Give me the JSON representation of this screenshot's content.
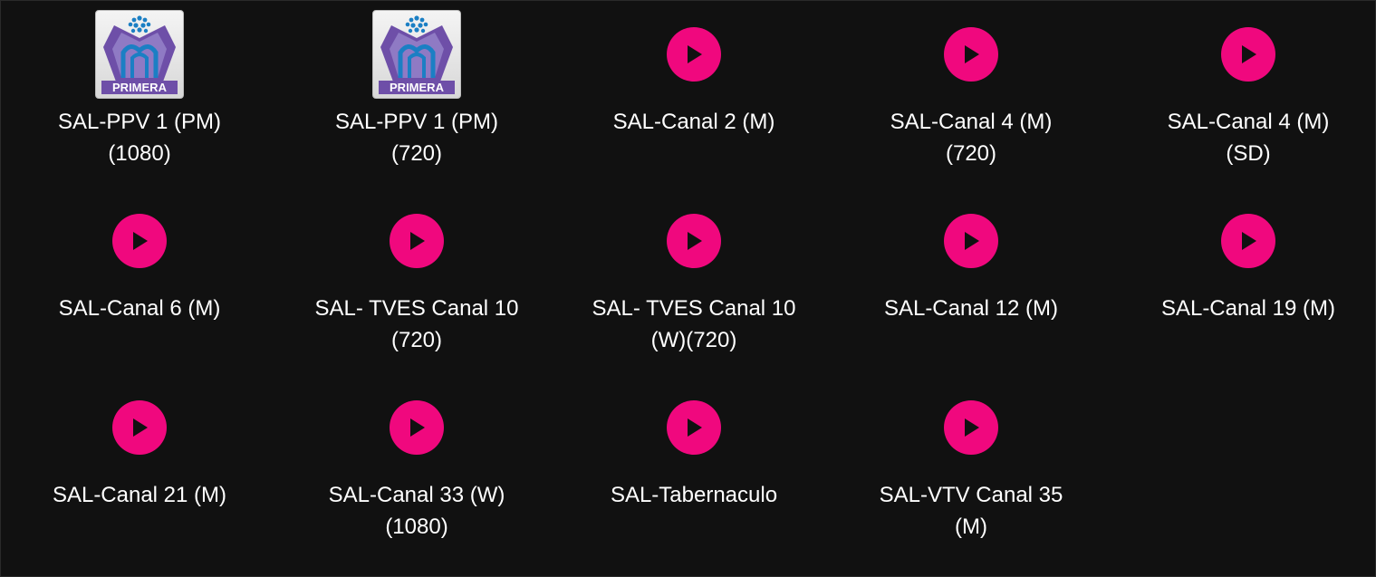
{
  "colors": {
    "background": "#111111",
    "play_accent": "#f0087e",
    "text": "#ffffff",
    "logo_purple": "#6e4fa8",
    "logo_blue": "#1b7fc4"
  },
  "channels": [
    {
      "label": "SAL-PPV 1 (PM)\n(1080)",
      "icon": "primera-logo-icon",
      "logo_text": "PRIMERA"
    },
    {
      "label": "SAL-PPV 1 (PM)\n(720)",
      "icon": "primera-logo-icon",
      "logo_text": "PRIMERA"
    },
    {
      "label": "SAL-Canal 2 (M)",
      "icon": "play-icon"
    },
    {
      "label": "SAL-Canal 4 (M)\n(720)",
      "icon": "play-icon"
    },
    {
      "label": "SAL-Canal 4 (M)\n(SD)",
      "icon": "play-icon"
    },
    {
      "label": "SAL-Canal 6 (M)",
      "icon": "play-icon"
    },
    {
      "label": "SAL- TVES Canal 10\n(720)",
      "icon": "play-icon"
    },
    {
      "label": "SAL- TVES Canal 10\n(W)(720)",
      "icon": "play-icon"
    },
    {
      "label": "SAL-Canal 12 (M)",
      "icon": "play-icon"
    },
    {
      "label": "SAL-Canal 19 (M)",
      "icon": "play-icon"
    },
    {
      "label": "SAL-Canal 21 (M)",
      "icon": "play-icon"
    },
    {
      "label": "SAL-Canal 33 (W)\n(1080)",
      "icon": "play-icon"
    },
    {
      "label": "SAL-Tabernaculo",
      "icon": "play-icon"
    },
    {
      "label": "SAL-VTV Canal 35\n(M)",
      "icon": "play-icon"
    }
  ]
}
